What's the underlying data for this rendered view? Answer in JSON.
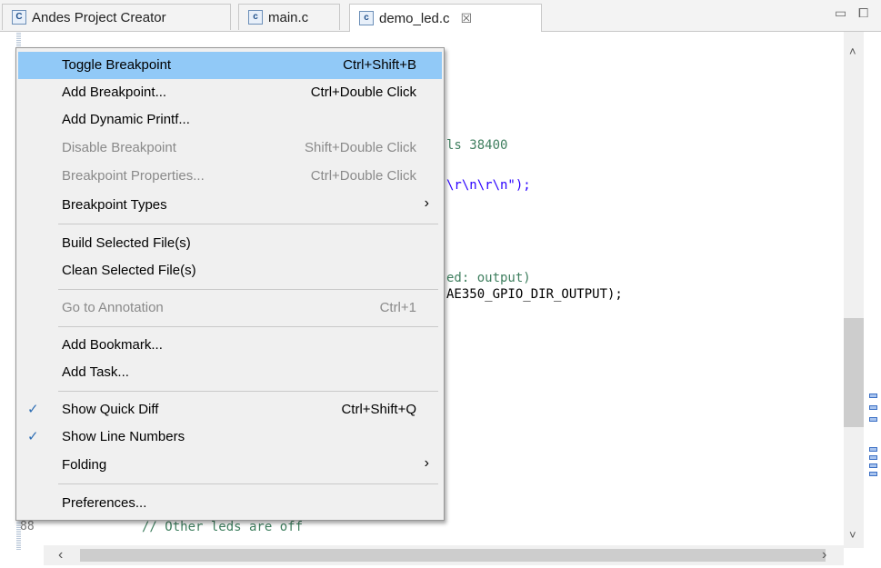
{
  "tabs": [
    {
      "label": "Andes Project Creator",
      "icon": "project-creator-icon"
    },
    {
      "label": "main.c",
      "icon": "c-file-icon"
    },
    {
      "label": "demo_led.c",
      "icon": "c-file-icon",
      "close": "☒"
    }
  ],
  "window_controls": {
    "minimize": "▭",
    "maximize": "⧠"
  },
  "editor": {
    "code_lines": [
      {
        "text": "ls 38400",
        "kind": "cmt"
      },
      {
        "text": "\\r\\n\\r\\n\");",
        "kind": "str"
      },
      {
        "text": "ed: output)",
        "kind": "cmt"
      },
      {
        "text": "AE350_GPIO_DIR_OUTPUT);",
        "kind": "code"
      },
      {
        "text": "// Other leds are off",
        "kind": "cmt"
      }
    ],
    "line_numbers": [
      "88"
    ]
  },
  "menu": {
    "items": [
      {
        "label": "Toggle Breakpoint",
        "shortcut": "Ctrl+Shift+B"
      },
      {
        "label": "Add Breakpoint...",
        "shortcut": "Ctrl+Double Click"
      },
      {
        "label": "Add Dynamic Printf..."
      },
      {
        "label": "Disable Breakpoint",
        "shortcut": "Shift+Double Click"
      },
      {
        "label": "Breakpoint Properties...",
        "shortcut": "Ctrl+Double Click"
      },
      {
        "label": "Breakpoint Types",
        "submenu": "›"
      },
      {
        "label": "Build Selected File(s)"
      },
      {
        "label": "Clean Selected File(s)"
      },
      {
        "label": "Go to Annotation",
        "shortcut": "Ctrl+1"
      },
      {
        "label": "Add Bookmark..."
      },
      {
        "label": "Add Task..."
      },
      {
        "label": "Show Quick Diff",
        "shortcut": "Ctrl+Shift+Q",
        "check": "✓"
      },
      {
        "label": "Show Line Numbers",
        "check": "✓"
      },
      {
        "label": "Folding",
        "submenu": "›"
      },
      {
        "label": "Preferences..."
      }
    ]
  },
  "scrollbars": {
    "up": "˄",
    "down": "˅",
    "left": "‹",
    "right": "›"
  }
}
